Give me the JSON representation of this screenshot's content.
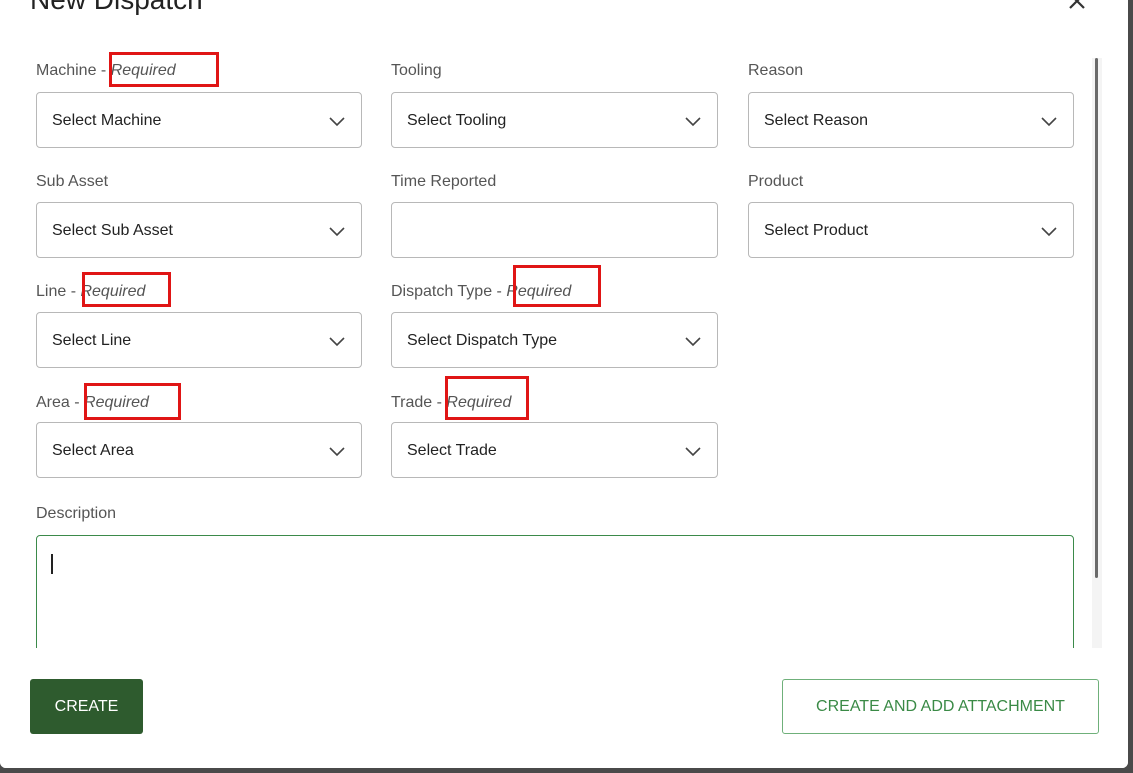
{
  "modal": {
    "title": "New Dispatch",
    "close_icon": "close-icon"
  },
  "fields": {
    "machine": {
      "label": "Machine",
      "separator": " - ",
      "required": "Required",
      "value": "Select Machine"
    },
    "tooling": {
      "label": "Tooling",
      "value": "Select Tooling"
    },
    "reason": {
      "label": "Reason",
      "value": "Select Reason"
    },
    "sub_asset": {
      "label": "Sub Asset",
      "value": "Select Sub Asset"
    },
    "time_reported": {
      "label": "Time Reported",
      "value": ""
    },
    "product": {
      "label": "Product",
      "value": "Select Product"
    },
    "line": {
      "label": "Line",
      "separator": " - ",
      "required": "Required",
      "value": "Select Line"
    },
    "dispatch_type": {
      "label": "Dispatch Type",
      "separator": " - ",
      "required": "Required",
      "value": "Select Dispatch Type"
    },
    "area": {
      "label": "Area",
      "separator": " - ",
      "required": "Required",
      "value": "Select Area"
    },
    "trade": {
      "label": "Trade",
      "separator": " - ",
      "required": "Required",
      "value": "Select Trade"
    },
    "description": {
      "label": "Description",
      "value": ""
    }
  },
  "buttons": {
    "create": "CREATE",
    "create_and_attach": "CREATE AND ADD ATTACHMENT"
  },
  "colors": {
    "primary": "#2e5b2e",
    "accent_green": "#3a8a46",
    "highlight_box": "#e01515"
  },
  "icons": {
    "dropdown": "chevron-down-icon"
  }
}
